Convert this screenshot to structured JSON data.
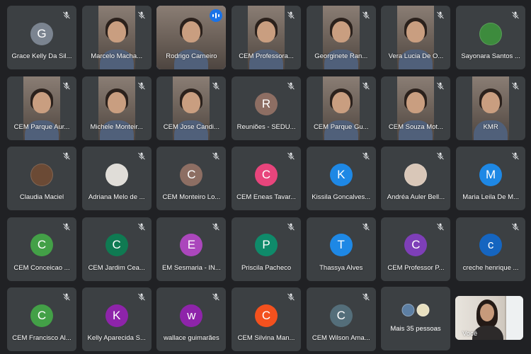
{
  "colors": {
    "background": "#202124",
    "tile": "#3c4043",
    "speaking_outline": "#8ab4f8"
  },
  "participants": [
    {
      "name": "Grace Kelly Da Sil...",
      "initial": "G",
      "avatar_color": "#7b8490",
      "type": "avatar",
      "muted": true
    },
    {
      "name": "Marcelo Macha...",
      "initial": "",
      "type": "video",
      "muted": true
    },
    {
      "name": "Rodrigo Carneiro",
      "initial": "",
      "type": "video",
      "speaking": true,
      "muted": false
    },
    {
      "name": "CEM Professora...",
      "initial": "",
      "type": "video",
      "muted": true
    },
    {
      "name": "Georginete Ran...",
      "initial": "",
      "type": "video",
      "muted": true
    },
    {
      "name": "Vera Lucia De O...",
      "initial": "",
      "type": "video",
      "muted": true
    },
    {
      "name": "Sayonara Santos ...",
      "initial": "",
      "avatar_color": "#3d8b3d",
      "type": "photo",
      "muted": true
    },
    {
      "name": "CEM Parque Aur...",
      "initial": "",
      "type": "video",
      "muted": true
    },
    {
      "name": "Michele Monteir...",
      "initial": "",
      "type": "video",
      "muted": true
    },
    {
      "name": "CEM Jose Candi...",
      "initial": "",
      "type": "video",
      "muted": true
    },
    {
      "name": "Reuniões - SEDU...",
      "initial": "R",
      "avatar_color": "#8d6e63",
      "type": "avatar",
      "muted": true
    },
    {
      "name": "CEM Parque Gu...",
      "initial": "",
      "type": "video",
      "muted": true
    },
    {
      "name": "CEM Souza Mot...",
      "initial": "",
      "type": "video",
      "muted": true
    },
    {
      "name": "KMR",
      "initial": "",
      "type": "video",
      "muted": true
    },
    {
      "name": "Claudia Maciel",
      "initial": "",
      "avatar_color": "#6b4a35",
      "type": "photo",
      "muted": true
    },
    {
      "name": "Adriana Melo de ...",
      "initial": "",
      "avatar_color": "#e0ddd8",
      "type": "photo",
      "muted": true
    },
    {
      "name": "CEM Monteiro Lo...",
      "initial": "C",
      "avatar_color": "#8d6e63",
      "type": "avatar",
      "muted": true
    },
    {
      "name": "CEM Eneas Tavar...",
      "initial": "C",
      "avatar_color": "#e8457c",
      "type": "avatar",
      "muted": true
    },
    {
      "name": "Kissila Goncalves...",
      "initial": "K",
      "avatar_color": "#1e88e5",
      "type": "avatar",
      "muted": true
    },
    {
      "name": "Andréa Auler Bell...",
      "initial": "",
      "avatar_color": "#d9c7b8",
      "type": "photo",
      "muted": true
    },
    {
      "name": "Maria Leila De M...",
      "initial": "M",
      "avatar_color": "#1e88e5",
      "type": "avatar",
      "muted": true
    },
    {
      "name": "CEM Conceicao ...",
      "initial": "C",
      "avatar_color": "#43a047",
      "type": "avatar",
      "muted": true
    },
    {
      "name": "CEM Jardim Cea...",
      "initial": "C",
      "avatar_color": "#0f7a52",
      "type": "avatar",
      "muted": true
    },
    {
      "name": "EM Sesmaria - IN...",
      "initial": "E",
      "avatar_color": "#ab47bc",
      "type": "avatar",
      "muted": true
    },
    {
      "name": "Priscila Pacheco",
      "initial": "P",
      "avatar_color": "#0f8a6a",
      "type": "avatar",
      "muted": true
    },
    {
      "name": "Thassya Alves",
      "initial": "T",
      "avatar_color": "#1e88e5",
      "type": "avatar",
      "muted": true
    },
    {
      "name": "CEM Professor P...",
      "initial": "C",
      "avatar_color": "#7e3fb8",
      "type": "avatar",
      "muted": true
    },
    {
      "name": "creche henrique ...",
      "initial": "c",
      "avatar_color": "#1565c0",
      "type": "avatar",
      "muted": true
    },
    {
      "name": "CEM Francisco Al...",
      "initial": "C",
      "avatar_color": "#43a047",
      "type": "avatar",
      "muted": true
    },
    {
      "name": "Kelly Aparecida S...",
      "initial": "K",
      "avatar_color": "#8e24aa",
      "type": "avatar",
      "muted": true
    },
    {
      "name": "wallace guimarães",
      "initial": "w",
      "avatar_color": "#8e24aa",
      "type": "avatar",
      "muted": true
    },
    {
      "name": "CEM Silvina Man...",
      "initial": "C",
      "avatar_color": "#f4511e",
      "type": "avatar",
      "muted": true
    },
    {
      "name": "CEM Wilson Ama...",
      "initial": "C",
      "avatar_color": "#546e7a",
      "type": "avatar",
      "muted": true
    }
  ],
  "more_tile": {
    "label": "Mais 35 pessoas",
    "avatar_colors": [
      "#5d7fa3",
      "#e8e0c0"
    ]
  },
  "self_view": {
    "name": "Você"
  }
}
